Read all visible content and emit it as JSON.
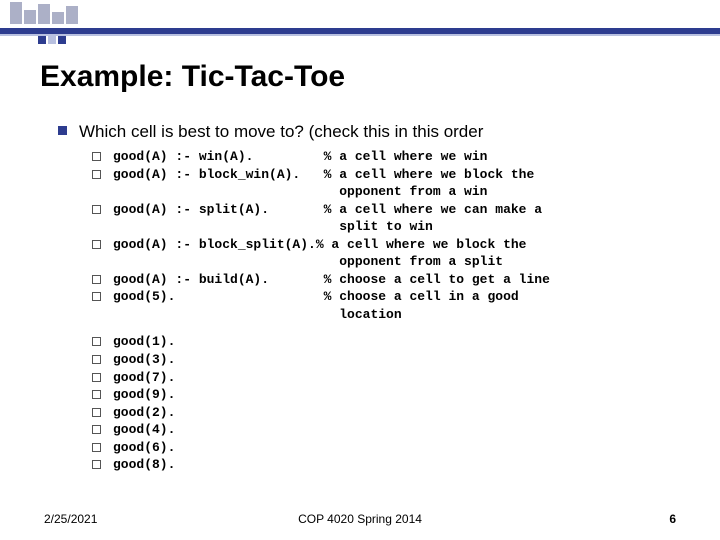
{
  "title": "Example: Tic-Tac-Toe",
  "lead": "Which cell is best to move to? (check this in this order",
  "rules": [
    {
      "code": "good(A) :- win(A).",
      "comment": "% a cell where we win"
    },
    {
      "code": "good(A) :- block_win(A).",
      "comment": "% a cell where we block the"
    },
    {
      "code": "",
      "comment": "  opponent from a win",
      "nobox": true
    },
    {
      "code": "good(A) :- split(A).",
      "comment": "% a cell where we can make a"
    },
    {
      "code": "",
      "comment": "  split to win",
      "nobox": true
    },
    {
      "code": "good(A) :- block_split(A).",
      "comment": "% a cell where we block the",
      "tight": true
    },
    {
      "code": "",
      "comment": "  opponent from a split",
      "nobox": true
    },
    {
      "code": "good(A) :- build(A).",
      "comment": "% choose a cell to get a line"
    },
    {
      "code": "good(5).",
      "comment": "% choose a cell in a good"
    },
    {
      "code": "",
      "comment": "  location",
      "nobox": true
    }
  ],
  "simple": [
    "good(1).",
    "good(3).",
    "good(7).",
    "good(9).",
    "good(2).",
    "good(4).",
    "good(6).",
    "good(8)."
  ],
  "footer": {
    "date": "2/25/2021",
    "course": "COP 4020 Spring 2014",
    "page": "6"
  }
}
